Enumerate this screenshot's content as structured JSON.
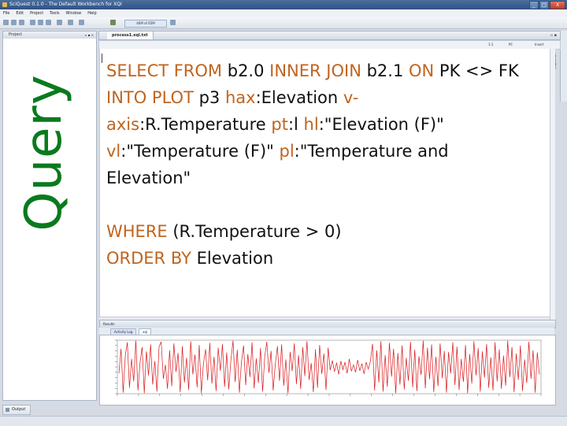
{
  "window": {
    "title": "SciQuest 0.1.0 - The Default Workbench for XQI",
    "controls": [
      "_",
      "□",
      "X"
    ]
  },
  "menu": [
    "File",
    "Edit",
    "Project",
    "Tools",
    "Window",
    "Help"
  ],
  "toolbar": {
    "memory": "46M of 65M"
  },
  "project_panel": {
    "label": "Project",
    "controls": "▫ ▪ ×"
  },
  "slide_label": "Query",
  "editor": {
    "tab_label": "process1.xql.txt",
    "tab_controls": "▫ ▪",
    "status": {
      "position": "1:1",
      "platform": "PC",
      "mode": "Insert"
    },
    "inspection_label": "Inspection",
    "lines": [
      {
        "parts": [
          {
            "t": "SELECT FROM",
            "k": true
          },
          {
            "t": " b2.0 ",
            "k": false
          },
          {
            "t": "INNER JOIN",
            "k": true
          },
          {
            "t": " b2.1 ",
            "k": false
          },
          {
            "t": "ON",
            "k": true
          },
          {
            "t": " PK <> FK",
            "k": false
          }
        ]
      },
      {
        "parts": [
          {
            "t": "INTO PLOT",
            "k": true
          },
          {
            "t": " p3 ",
            "k": false
          },
          {
            "t": "hax",
            "k": true
          },
          {
            "t": ":Elevation ",
            "k": false
          },
          {
            "t": "v-",
            "k": true
          }
        ]
      },
      {
        "parts": [
          {
            "t": "axis",
            "k": true
          },
          {
            "t": ":R.Temperature ",
            "k": false
          },
          {
            "t": "pt",
            "k": true
          },
          {
            "t": ":l ",
            "k": false
          },
          {
            "t": "hl",
            "k": true
          },
          {
            "t": ":\"Elevation (F)\"",
            "k": false
          }
        ]
      },
      {
        "parts": [
          {
            "t": "vl",
            "k": true
          },
          {
            "t": ":\"Temperature (F)\" ",
            "k": false
          },
          {
            "t": "pl",
            "k": true
          },
          {
            "t": ":\"Temperature and",
            "k": false
          }
        ]
      },
      {
        "parts": [
          {
            "t": "Elevation\"",
            "k": false
          }
        ]
      },
      {
        "parts": []
      },
      {
        "parts": [
          {
            "t": "WHERE",
            "k": true
          },
          {
            "t": " (R.Temperature > 0)",
            "k": false
          }
        ]
      },
      {
        "parts": [
          {
            "t": "ORDER BY",
            "k": true
          },
          {
            "t": " Elevation",
            "k": false
          }
        ]
      }
    ]
  },
  "results": {
    "label": "Results",
    "tabs": [
      "Activity Log",
      "xql"
    ],
    "active_tab": 1
  },
  "chart_data": {
    "type": "line",
    "series": [
      {
        "values": [
          -1.2,
          3.4,
          -4.8,
          2.1,
          4.6,
          -3.9,
          1.5,
          -2.7,
          4.9,
          -4.4,
          0.8,
          3.7,
          -4.9,
          2.9,
          -1.6,
          4.2,
          -3.3,
          1.1,
          -4.6,
          3.8,
          4.7,
          -2.2,
          0.4,
          -4.1,
          3.1,
          -3.6,
          4.4,
          -0.9,
          2.6,
          -4.7,
          3.9,
          -2.9,
          1.7,
          -4.3,
          4.8,
          -1.4,
          2.3,
          -3.8,
          4.1,
          -4.9,
          0.6,
          3.3,
          -2.5,
          4.5,
          -3.1,
          1.9,
          -4.5,
          3.6,
          -0.7,
          4.3,
          -3.7,
          2.7,
          -4.2,
          1.3,
          4.9,
          -2.8,
          3.2,
          -4.8,
          0.9,
          4.0,
          -3.4,
          2.4,
          -1.9,
          4.6,
          -4.0,
          1.6,
          -3.0,
          3.5,
          -4.6,
          2.0,
          4.7,
          -1.1,
          3.0,
          -4.4,
          0.5,
          3.9,
          -2.6,
          4.2,
          -3.5,
          1.4,
          -4.9,
          2.8,
          -0.8,
          4.4,
          -3.2,
          2.2,
          -4.1,
          3.7,
          -1.7,
          4.8,
          -2.4,
          0.7,
          -4.7,
          3.3,
          -3.9,
          4.1,
          -1.3,
          2.5,
          -4.3,
          3.6,
          -0.6,
          1.2,
          -0.9,
          0.8,
          -1.4,
          1.1,
          -0.5,
          0.9,
          -1.2,
          1.5,
          -0.8,
          0.4,
          -1.0,
          1.3,
          -0.7,
          0.6,
          -1.3,
          0.9,
          -0.4,
          1.0,
          4.3,
          -4.4,
          3.1,
          -2.9,
          4.8,
          -4.6,
          2.2,
          -3.7,
          4.5,
          -1.8,
          3.4,
          -4.9,
          2.6,
          -3.3,
          4.0,
          -4.2,
          1.7,
          -2.6,
          4.7,
          -3.8,
          3.2,
          -4.5,
          2.0,
          -1.5,
          4.9,
          -4.0,
          3.6,
          -2.3,
          4.2,
          -4.7,
          1.9,
          -3.6,
          4.4,
          -2.1,
          3.0,
          -4.8,
          2.8,
          -1.2,
          4.6,
          -3.4,
          3.8,
          -4.3,
          1.5,
          -2.8,
          4.1,
          -4.9,
          2.4,
          -3.1,
          4.8,
          -1.6,
          3.5,
          -4.6,
          2.9,
          -2.0,
          4.3,
          -3.9,
          1.8,
          -4.4,
          4.6,
          -2.7,
          3.3,
          -4.1,
          2.1,
          -3.5,
          4.9,
          -1.9,
          3.7,
          -4.7,
          2.5,
          -2.4,
          4.0,
          -4.5,
          1.4,
          -3.0,
          4.7,
          -2.2,
          3.1,
          -4.8,
          2.7,
          -1.4
        ],
        "color": "#d9161a"
      }
    ],
    "ylim": [
      -5,
      5
    ],
    "grid": false
  }
}
